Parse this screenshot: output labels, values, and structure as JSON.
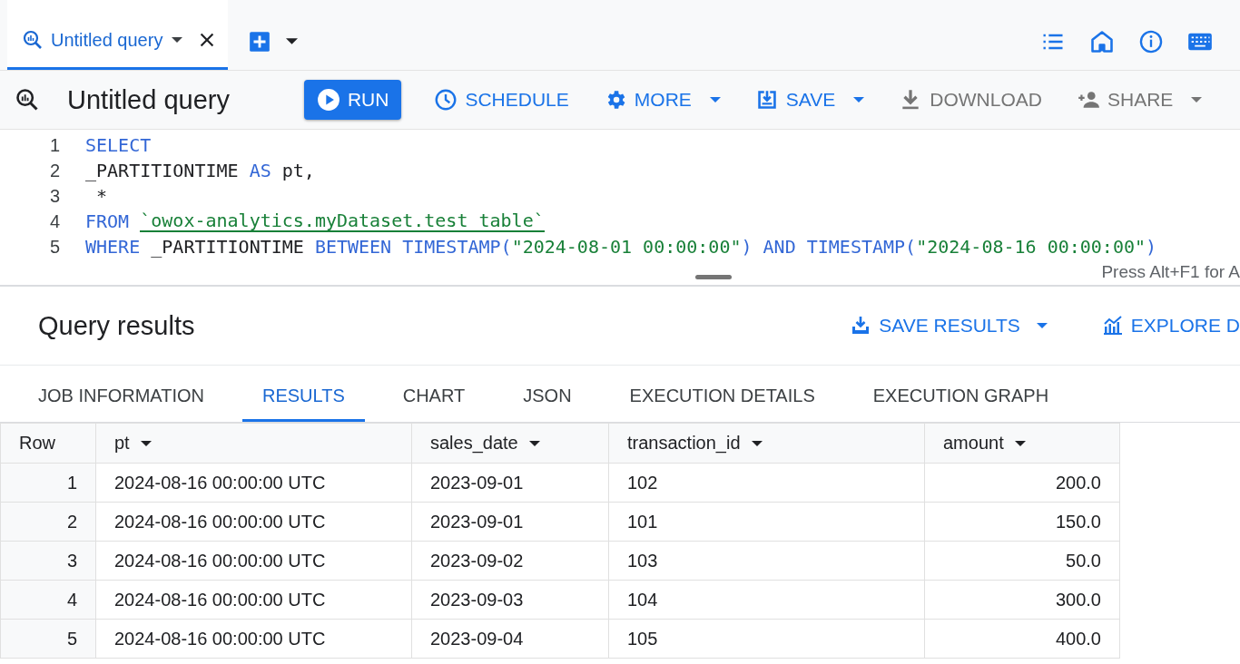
{
  "query_tabs": [
    {
      "label": "Untitled query",
      "selected": true
    }
  ],
  "toolbar": {
    "title": "Untitled query",
    "buttons": [
      {
        "label": "RUN",
        "kind": "run",
        "disabled": false,
        "dropdown": false
      },
      {
        "label": "SCHEDULE",
        "kind": "schedule",
        "disabled": false,
        "dropdown": false
      },
      {
        "label": "MORE",
        "kind": "more",
        "disabled": false,
        "dropdown": true
      },
      {
        "label": "SAVE",
        "kind": "save",
        "disabled": false,
        "dropdown": true
      },
      {
        "label": "DOWNLOAD",
        "kind": "download",
        "disabled": true,
        "dropdown": false
      },
      {
        "label": "SHARE",
        "kind": "share",
        "disabled": true,
        "dropdown": true
      }
    ]
  },
  "editor": {
    "lines": [
      {
        "number": "1",
        "tokens": [
          {
            "text": "SELECT",
            "kind": "keyword"
          }
        ]
      },
      {
        "number": "2",
        "tokens": [
          {
            "text": "_PARTITIONTIME ",
            "kind": "plain"
          },
          {
            "text": "AS",
            "kind": "keyword"
          },
          {
            "text": " pt,",
            "kind": "plain"
          }
        ]
      },
      {
        "number": "3",
        "tokens": [
          {
            "text": " *",
            "kind": "plain"
          }
        ]
      },
      {
        "number": "4",
        "tokens": [
          {
            "text": "FROM ",
            "kind": "keyword"
          },
          {
            "text": "`owox-analytics.myDataset.test_table`",
            "kind": "ref"
          }
        ]
      },
      {
        "number": "5",
        "tokens": [
          {
            "text": "WHERE",
            "kind": "keyword"
          },
          {
            "text": " _PARTITIONTIME ",
            "kind": "plain"
          },
          {
            "text": "BETWEEN TIMESTAMP(",
            "kind": "keyword"
          },
          {
            "text": "\"2024-08-01 00:00:00\"",
            "kind": "string"
          },
          {
            "text": ") AND TIMESTAMP(",
            "kind": "keyword"
          },
          {
            "text": "\"2024-08-16 00:00:00\"",
            "kind": "string"
          },
          {
            "text": ")",
            "kind": "keyword"
          }
        ]
      }
    ],
    "hint": "Press Alt+F1 for A"
  },
  "results": {
    "title": "Query results",
    "actions": [
      {
        "label": "SAVE RESULTS",
        "kind": "save-results",
        "dropdown": true
      },
      {
        "label": "EXPLORE D",
        "kind": "explore",
        "dropdown": false
      }
    ],
    "tabs": [
      {
        "label": "JOB INFORMATION",
        "selected": false
      },
      {
        "label": "RESULTS",
        "selected": true
      },
      {
        "label": "CHART",
        "selected": false
      },
      {
        "label": "JSON",
        "selected": false
      },
      {
        "label": "EXECUTION DETAILS",
        "selected": false
      },
      {
        "label": "EXECUTION GRAPH",
        "selected": false
      }
    ],
    "table": {
      "columns": [
        {
          "label": "Row",
          "kind": "index",
          "menu": false
        },
        {
          "label": "pt",
          "kind": "text",
          "menu": true
        },
        {
          "label": "sales_date",
          "kind": "text",
          "menu": true
        },
        {
          "label": "transaction_id",
          "kind": "text",
          "menu": true
        },
        {
          "label": "amount",
          "kind": "number",
          "menu": true
        }
      ],
      "rows": [
        [
          "1",
          "2024-08-16 00:00:00 UTC",
          "2023-09-01",
          "102",
          "200.0"
        ],
        [
          "2",
          "2024-08-16 00:00:00 UTC",
          "2023-09-01",
          "101",
          "150.0"
        ],
        [
          "3",
          "2024-08-16 00:00:00 UTC",
          "2023-09-02",
          "103",
          "50.0"
        ],
        [
          "4",
          "2024-08-16 00:00:00 UTC",
          "2023-09-03",
          "104",
          "300.0"
        ],
        [
          "5",
          "2024-08-16 00:00:00 UTC",
          "2023-09-04",
          "105",
          "400.0"
        ]
      ]
    }
  }
}
